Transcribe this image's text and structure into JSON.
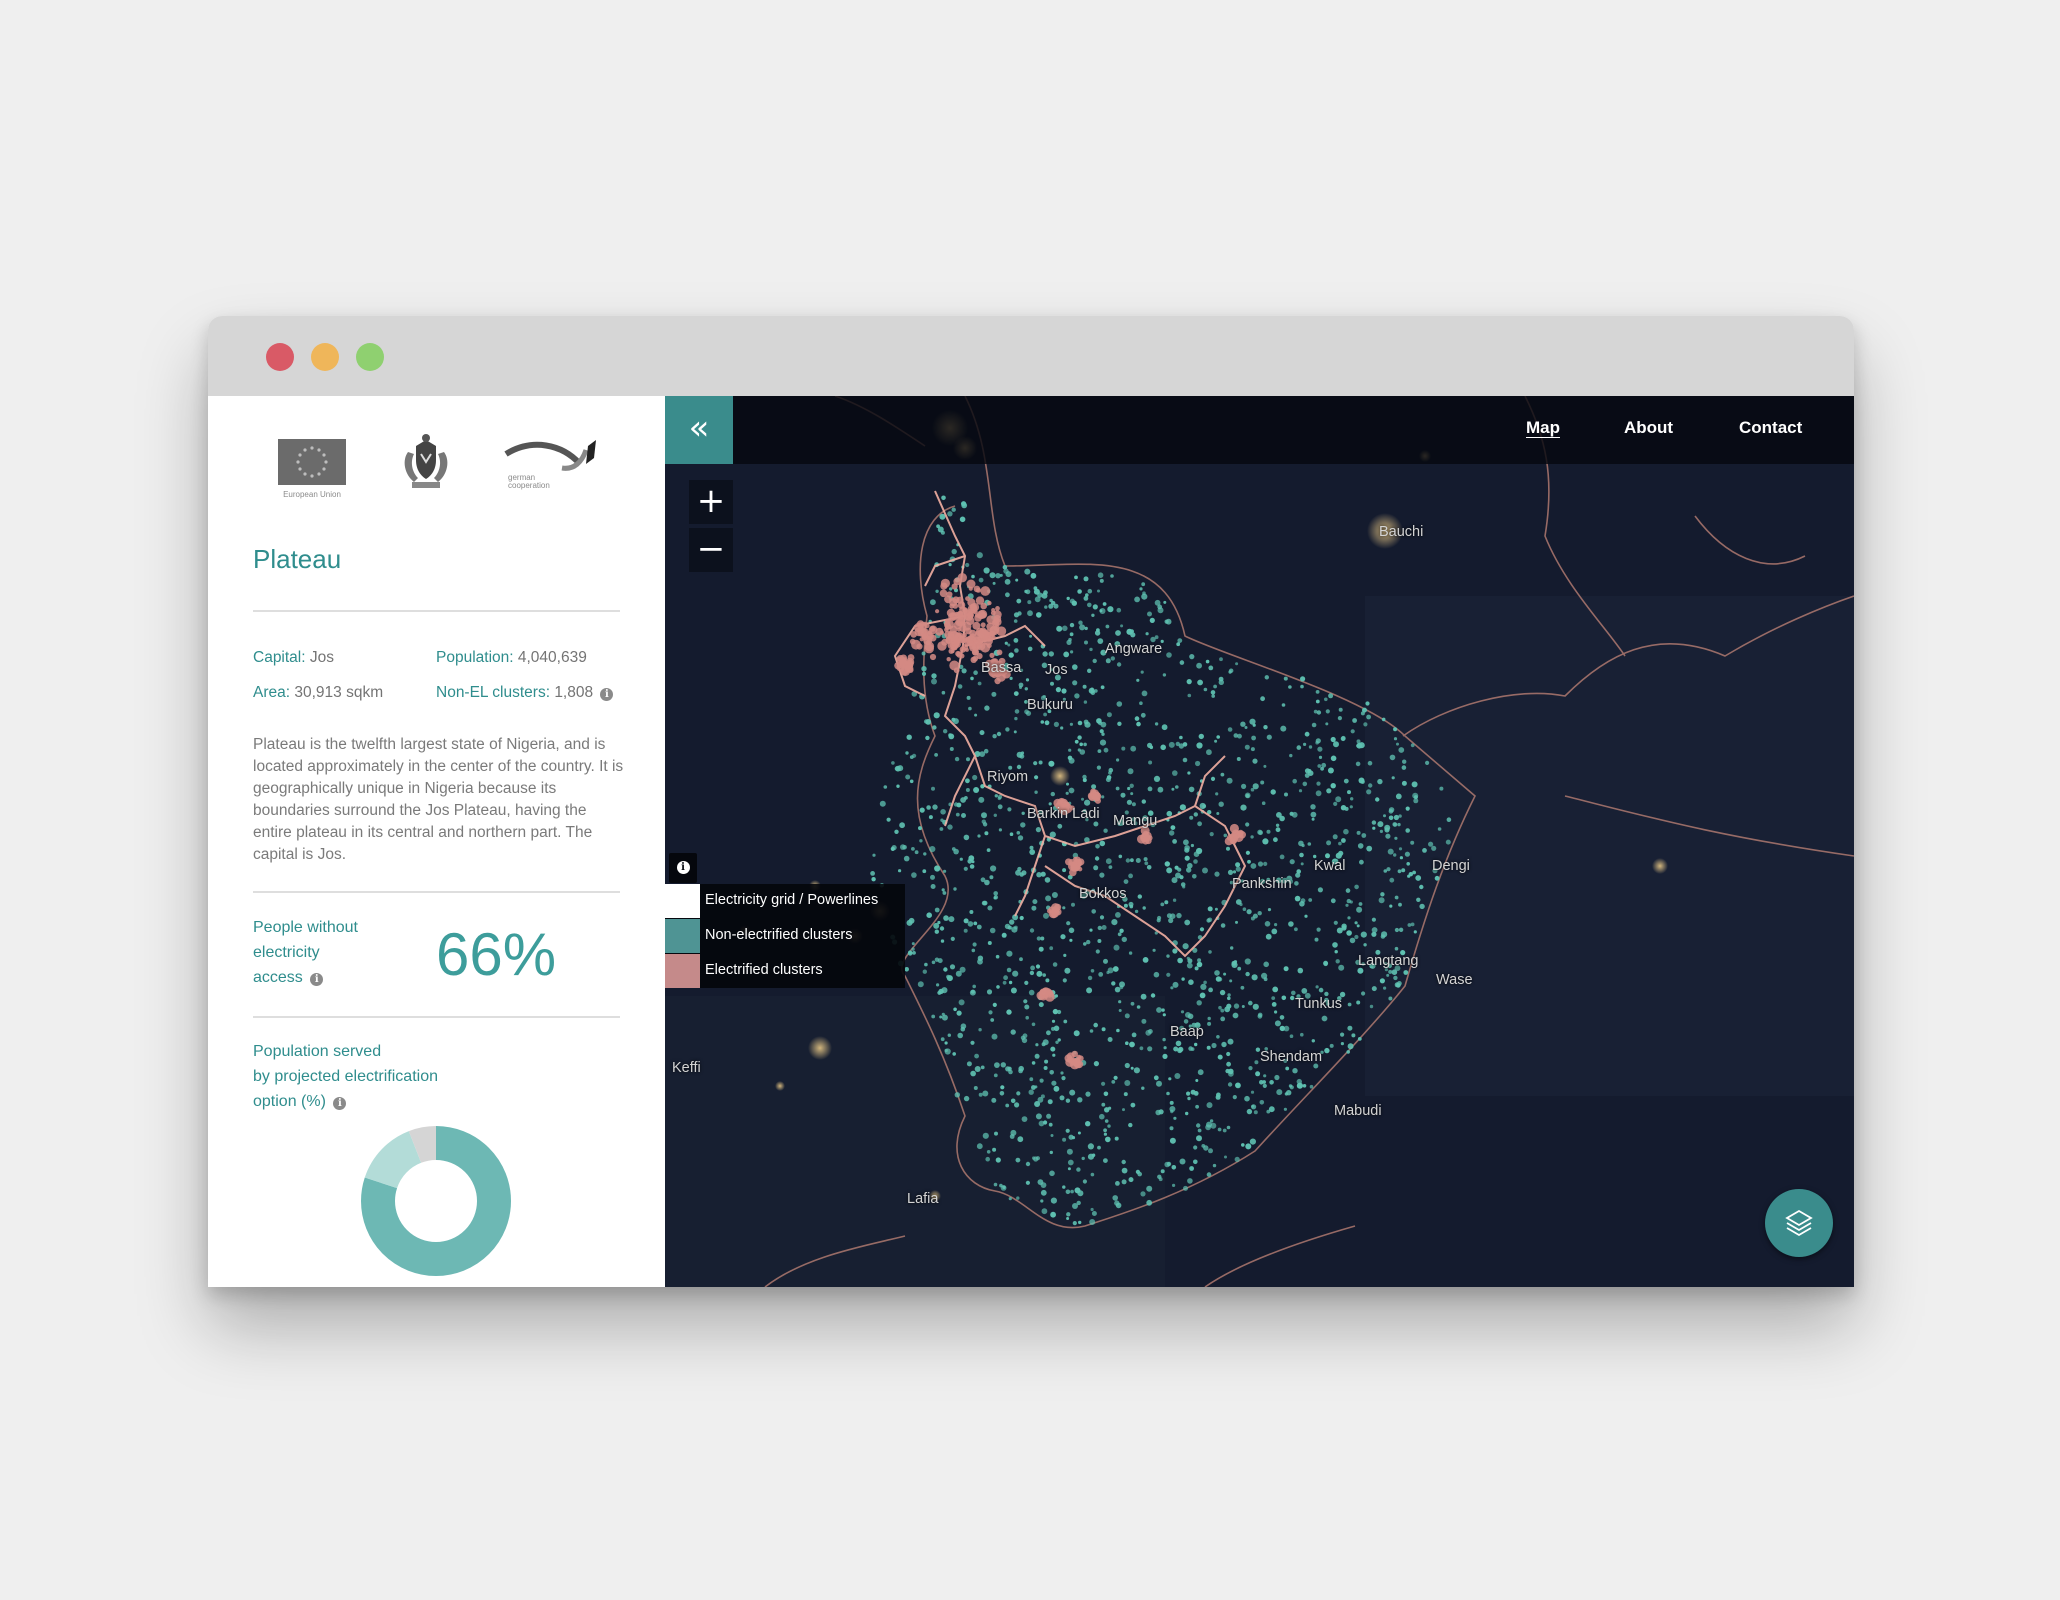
{
  "window": {
    "controls": [
      "close",
      "minimize",
      "maximize"
    ]
  },
  "sidebar": {
    "logos": {
      "eu_caption": "European Union",
      "gc_caption": "german cooperation"
    },
    "state_name": "Plateau",
    "facts": {
      "capital_label": "Capital:",
      "capital_value": "Jos",
      "population_label": "Population:",
      "population_value": "4,040,639",
      "area_label": "Area:",
      "area_value": "30,913 sqkm",
      "clusters_label": "Non-EL clusters:",
      "clusters_value": "1,808"
    },
    "description": "Plateau is the twelfth largest state of Nigeria, and is located approximately in the center of the country. It is geographically unique in Nigeria because its boundaries surround the Jos Plateau, having the entire plateau in its central and northern part. The capital is Jos.",
    "kpi": {
      "label_line1": "People without",
      "label_line2": "electricity",
      "label_line3": "access",
      "value": "66%"
    },
    "population_served": {
      "label_line1": "Population served",
      "label_line2": "by projected electrification",
      "label_line3": "option (%)",
      "segments": [
        {
          "share": 0.8,
          "color": "#6db8b4"
        },
        {
          "share": 0.14,
          "color": "#b3dcd8"
        },
        {
          "share": 0.06,
          "color": "#d5d5d5"
        }
      ]
    }
  },
  "map": {
    "nav": {
      "map": "Map",
      "about": "About",
      "contact": "Contact"
    },
    "collapse_icon": "«",
    "zoom_in": "+",
    "zoom_out": "−",
    "info_icon": "i",
    "legend": [
      {
        "label": "Electricity grid / Powerlines",
        "color": "#ffffff"
      },
      {
        "label": "Non-electrified clusters",
        "color": "#4f9494"
      },
      {
        "label": "Electrified clusters",
        "color": "#c58a8a"
      }
    ],
    "cities": {
      "bauchi": "Bauchi",
      "angware": "Angware",
      "bassa": "Bassa",
      "jos": "Jos",
      "bukuru": "Bukuru",
      "riyom": "Riyom",
      "barkin_ladi": "Barkin Ladi",
      "mangu": "Mangu",
      "kwal": "Kwal",
      "dengi": "Dengi",
      "pankshin": "Pankshin",
      "bokkos": "Bokkos",
      "langtang": "Langtang",
      "wase": "Wase",
      "tunkus": "Tunkus",
      "baap": "Baap",
      "shendam": "Shendam",
      "mabudi": "Mabudi",
      "keffi": "Keffi",
      "lafia": "Lafia"
    },
    "colors": {
      "background": "#131a2d",
      "non_electrified": "#5fc2b2",
      "electrified": "#d38a84",
      "boundary": "#c98a7a"
    },
    "layers_icon": "layers-icon"
  }
}
